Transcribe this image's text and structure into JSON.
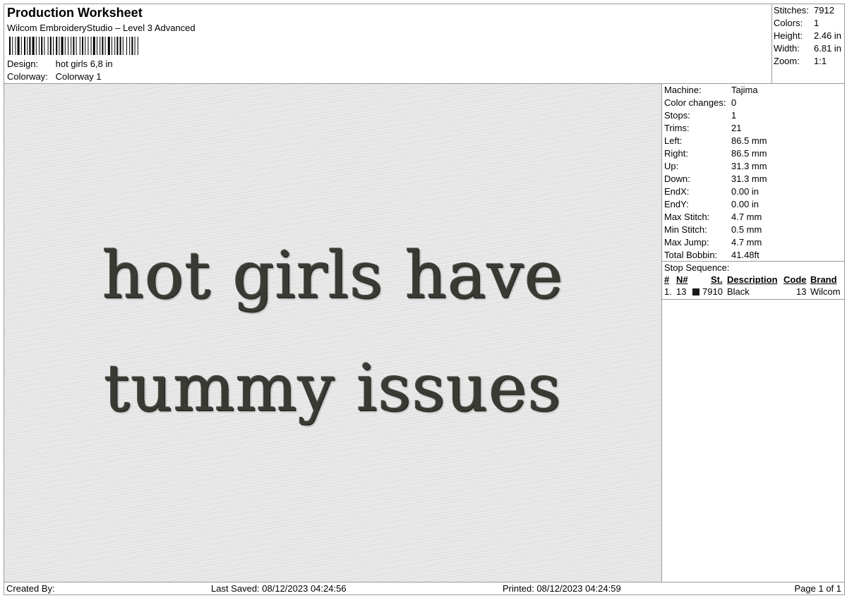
{
  "header": {
    "title": "Production Worksheet",
    "subtitle": "Wilcom EmbroideryStudio – Level 3 Advanced",
    "design_label": "Design:",
    "design_value": "hot girls 6,8 in",
    "colorway_label": "Colorway:",
    "colorway_value": "Colorway 1"
  },
  "summary": [
    {
      "label": "Stitches:",
      "value": "7912"
    },
    {
      "label": "Colors:",
      "value": "1"
    },
    {
      "label": "Height:",
      "value": "2.46 in"
    },
    {
      "label": "Width:",
      "value": "6.81 in"
    },
    {
      "label": "Zoom:",
      "value": "1:1"
    }
  ],
  "design_preview": {
    "line1": "hot girls have",
    "line2": "tummy issues",
    "thread_color": "#3a3a34",
    "fabric_color": "#e5e5e5"
  },
  "machine_info": [
    {
      "label": "Machine:",
      "value": "Tajima"
    },
    {
      "label": "Color changes:",
      "value": "0"
    },
    {
      "label": "Stops:",
      "value": "1"
    },
    {
      "label": "Trims:",
      "value": "21"
    },
    {
      "label": "Left:",
      "value": "86.5 mm"
    },
    {
      "label": "Right:",
      "value": "86.5 mm"
    },
    {
      "label": "Up:",
      "value": "31.3 mm"
    },
    {
      "label": "Down:",
      "value": "31.3 mm"
    },
    {
      "label": "EndX:",
      "value": "0.00 in"
    },
    {
      "label": "EndY:",
      "value": "0.00 in"
    },
    {
      "label": "Max Stitch:",
      "value": "4.7 mm"
    },
    {
      "label": "Min Stitch:",
      "value": "0.5 mm"
    },
    {
      "label": "Max Jump:",
      "value": "4.7 mm"
    },
    {
      "label": "Total Bobbin:",
      "value": "41.48ft"
    }
  ],
  "stop_sequence": {
    "heading": "Stop Sequence:",
    "columns": {
      "num": "#",
      "n": "N#",
      "st": "St.",
      "description": "Description",
      "code": "Code",
      "brand": "Brand"
    },
    "rows": [
      {
        "num": "1.",
        "n": "13",
        "swatch": "#1a1a1a",
        "st": "7910",
        "description": "Black",
        "code": "13",
        "brand": "Wilcom"
      }
    ]
  },
  "footer": {
    "created_by": "Created By:",
    "last_saved": "Last Saved: 08/12/2023 04:24:56",
    "printed": "Printed: 08/12/2023 04:24:59",
    "page": "Page 1 of 1"
  }
}
